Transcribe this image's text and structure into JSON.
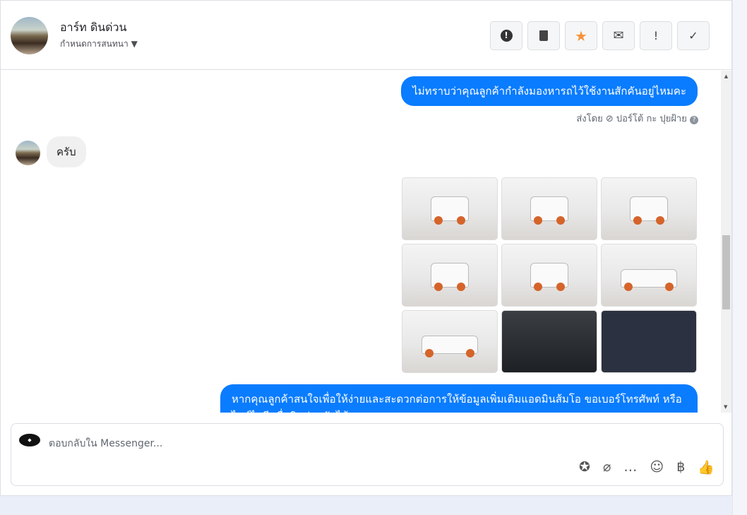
{
  "header": {
    "contact_name": "อาร์ท ดินด่วน",
    "subtitle": "กำหนดการสนทนา",
    "buttons": [
      {
        "name": "spam-button",
        "icon": "exclamation-circle-icon",
        "glyph": "⬤"
      },
      {
        "name": "delete-button",
        "icon": "trash-icon",
        "glyph": "🗑"
      },
      {
        "name": "star-button",
        "icon": "star-icon",
        "glyph": "★"
      },
      {
        "name": "mark-unread-button",
        "icon": "envelope-icon",
        "glyph": "✉"
      },
      {
        "name": "important-button",
        "icon": "exclamation-icon",
        "glyph": "!"
      },
      {
        "name": "done-button",
        "icon": "check-icon",
        "glyph": "✓"
      }
    ]
  },
  "messages": {
    "out1": "ไม่ทราบว่าคุณลูกค้ากำลังมองหารถไว้ใช้งานสักคันอยู่ไหมคะ",
    "sent_by": "ส่งโดย ⊘ ปอร์โต้ กะ ปุยฝ้าย",
    "in1": "ครับ",
    "out2": "หากคุณลูกค้าสนใจเพื่อให้ง่ายและสะดวกต่อการให้ข้อมูลเพิ่มเติมแอดมินส้มโอ ขอเบอร์โทรศัพท์ หรือ ไลน์ไอดี เพื่อติดต่อกลับได้เลยนะคะ"
  },
  "composer": {
    "placeholder": "ตอบกลับใน Messenger...",
    "tools": [
      {
        "name": "saved-reply-icon",
        "glyph": "✪"
      },
      {
        "name": "attachment-icon",
        "glyph": "📎"
      },
      {
        "name": "chat-bubble-icon",
        "glyph": "💬"
      },
      {
        "name": "emoji-icon",
        "glyph": "☺"
      },
      {
        "name": "baht-icon",
        "glyph": "฿"
      },
      {
        "name": "like-icon",
        "glyph": "👍"
      }
    ]
  },
  "colors": {
    "accent": "#0a7cff",
    "star": "#f7923a"
  }
}
